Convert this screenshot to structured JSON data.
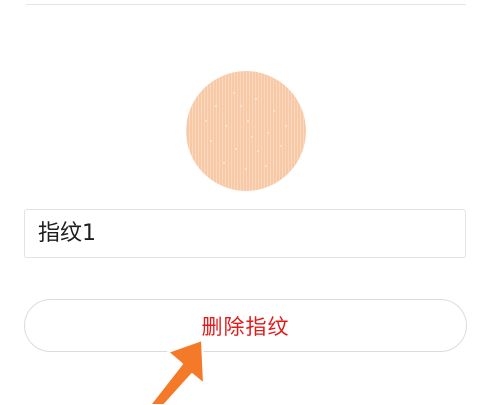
{
  "fingerprint": {
    "icon": "fingerprint-icon",
    "color": "#f8c9a6"
  },
  "name_field": {
    "value": "指纹1"
  },
  "delete_button": {
    "label": "删除指纹",
    "color": "#e21a1a"
  },
  "annotation": {
    "icon": "arrow-icon",
    "color": "#f47a2a"
  }
}
